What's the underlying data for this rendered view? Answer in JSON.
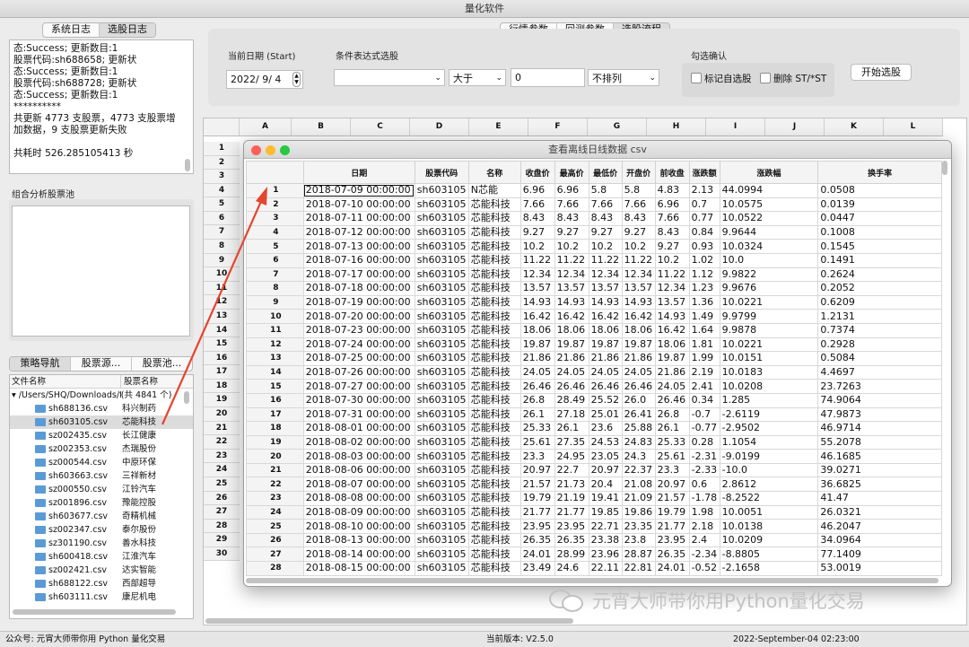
{
  "app": {
    "title": "量化软件"
  },
  "left": {
    "log_tabs": [
      "系统日志",
      "选股日志"
    ],
    "log_lines": [
      "态:Success; 更新数目:1",
      "股票代码:sh688658; 更新状",
      "态:Success; 更新数目:1",
      "股票代码:sh688728; 更新状",
      "态:Success; 更新数目:1",
      "**********",
      "共更新 4773 支股票，4773 支股票增",
      "加数据，9 支股票更新失败",
      "",
      "共耗时 526.285105413 秒"
    ],
    "combo_pool_title": "组合分析股票池",
    "nav_tabs": [
      "策略导航",
      "股票源...",
      "股票池..."
    ],
    "file_col_headers": [
      "文件名称",
      "股票名称"
    ],
    "root_path": "/Users/SHQ/Downloads/f",
    "root_count": "(共 4841 个)",
    "files": [
      {
        "file": "sh688136.csv",
        "name": "科兴制药"
      },
      {
        "file": "sh603105.csv",
        "name": "芯能科技"
      },
      {
        "file": "sz002435.csv",
        "name": "长江健康"
      },
      {
        "file": "sz002353.csv",
        "name": "杰瑞股份"
      },
      {
        "file": "sz000544.csv",
        "name": "中原环保"
      },
      {
        "file": "sh603663.csv",
        "name": "三祥新材"
      },
      {
        "file": "sz000550.csv",
        "name": "江铃汽车"
      },
      {
        "file": "sz001896.csv",
        "name": "豫能控股"
      },
      {
        "file": "sh603677.csv",
        "name": "奇精机械"
      },
      {
        "file": "sz002347.csv",
        "name": "泰尔股份"
      },
      {
        "file": "sz301190.csv",
        "name": "善水科技"
      },
      {
        "file": "sh600418.csv",
        "name": "江淮汽车"
      },
      {
        "file": "sz002421.csv",
        "name": "达实智能"
      },
      {
        "file": "sh688122.csv",
        "name": "西部超导"
      },
      {
        "file": "sh603111.csv",
        "name": "康尼机电"
      }
    ]
  },
  "top": {
    "tabs": [
      "行情参数",
      "回测参数",
      "选股流程"
    ],
    "date_label": "当前日期 (Start)",
    "date_value": "2022/  9/  4",
    "cond_label": "条件表达式选股",
    "cond_field": "",
    "operator": "大于",
    "threshold": "0",
    "sort": "不排列",
    "confirm_label": "勾选确认",
    "check_mark": "标记自选股",
    "check_del": "删除 ST/*ST",
    "start_button": "开始选股"
  },
  "sheet": {
    "cols": [
      "A",
      "B",
      "C",
      "D",
      "E",
      "F",
      "G",
      "H",
      "I",
      "J",
      "K",
      "L"
    ],
    "rows": [
      "1",
      "2",
      "3",
      "4",
      "5",
      "6",
      "7",
      "8",
      "9",
      "10",
      "11",
      "12",
      "13",
      "14",
      "15",
      "16",
      "17",
      "18",
      "19",
      "20",
      "21",
      "22",
      "23",
      "24",
      "25",
      "26",
      "27",
      "28",
      "29",
      "30"
    ]
  },
  "csv_window": {
    "title": "查看离线日线数据 csv",
    "headers": [
      "日期",
      "股票代码",
      "名称",
      "收盘价",
      "最高价",
      "最低价",
      "开盘价",
      "前收盘",
      "涨跌额",
      "涨跌幅",
      "换手率"
    ],
    "rows": [
      [
        "1",
        "2018-07-09 00:00:00",
        "sh603105",
        "N芯能",
        "6.96",
        "6.96",
        "5.8",
        "5.8",
        "4.83",
        "2.13",
        "44.0994",
        "0.0508"
      ],
      [
        "2",
        "2018-07-10 00:00:00",
        "sh603105",
        "芯能科技",
        "7.66",
        "7.66",
        "7.66",
        "7.66",
        "6.96",
        "0.7",
        "10.0575",
        "0.0139"
      ],
      [
        "3",
        "2018-07-11 00:00:00",
        "sh603105",
        "芯能科技",
        "8.43",
        "8.43",
        "8.43",
        "8.43",
        "7.66",
        "0.77",
        "10.0522",
        "0.0447"
      ],
      [
        "4",
        "2018-07-12 00:00:00",
        "sh603105",
        "芯能科技",
        "9.27",
        "9.27",
        "9.27",
        "9.27",
        "8.43",
        "0.84",
        "9.9644",
        "0.1008"
      ],
      [
        "5",
        "2018-07-13 00:00:00",
        "sh603105",
        "芯能科技",
        "10.2",
        "10.2",
        "10.2",
        "10.2",
        "9.27",
        "0.93",
        "10.0324",
        "0.1545"
      ],
      [
        "6",
        "2018-07-16 00:00:00",
        "sh603105",
        "芯能科技",
        "11.22",
        "11.22",
        "11.22",
        "11.22",
        "10.2",
        "1.02",
        "10.0",
        "0.1491"
      ],
      [
        "7",
        "2018-07-17 00:00:00",
        "sh603105",
        "芯能科技",
        "12.34",
        "12.34",
        "12.34",
        "12.34",
        "11.22",
        "1.12",
        "9.9822",
        "0.2624"
      ],
      [
        "8",
        "2018-07-18 00:00:00",
        "sh603105",
        "芯能科技",
        "13.57",
        "13.57",
        "13.57",
        "13.57",
        "12.34",
        "1.23",
        "9.9676",
        "0.2052"
      ],
      [
        "9",
        "2018-07-19 00:00:00",
        "sh603105",
        "芯能科技",
        "14.93",
        "14.93",
        "14.93",
        "14.93",
        "13.57",
        "1.36",
        "10.0221",
        "0.6209"
      ],
      [
        "10",
        "2018-07-20 00:00:00",
        "sh603105",
        "芯能科技",
        "16.42",
        "16.42",
        "16.42",
        "16.42",
        "14.93",
        "1.49",
        "9.9799",
        "1.2131"
      ],
      [
        "11",
        "2018-07-23 00:00:00",
        "sh603105",
        "芯能科技",
        "18.06",
        "18.06",
        "18.06",
        "18.06",
        "16.42",
        "1.64",
        "9.9878",
        "0.7374"
      ],
      [
        "12",
        "2018-07-24 00:00:00",
        "sh603105",
        "芯能科技",
        "19.87",
        "19.87",
        "19.87",
        "19.87",
        "18.06",
        "1.81",
        "10.0221",
        "0.2928"
      ],
      [
        "13",
        "2018-07-25 00:00:00",
        "sh603105",
        "芯能科技",
        "21.86",
        "21.86",
        "21.86",
        "21.86",
        "19.87",
        "1.99",
        "10.0151",
        "0.5084"
      ],
      [
        "14",
        "2018-07-26 00:00:00",
        "sh603105",
        "芯能科技",
        "24.05",
        "24.05",
        "24.05",
        "24.05",
        "21.86",
        "2.19",
        "10.0183",
        "4.4697"
      ],
      [
        "15",
        "2018-07-27 00:00:00",
        "sh603105",
        "芯能科技",
        "26.46",
        "26.46",
        "26.46",
        "26.46",
        "24.05",
        "2.41",
        "10.0208",
        "23.7263"
      ],
      [
        "16",
        "2018-07-30 00:00:00",
        "sh603105",
        "芯能科技",
        "26.8",
        "28.49",
        "25.52",
        "26.0",
        "26.46",
        "0.34",
        "1.285",
        "74.9064"
      ],
      [
        "17",
        "2018-07-31 00:00:00",
        "sh603105",
        "芯能科技",
        "26.1",
        "27.18",
        "25.01",
        "26.41",
        "26.8",
        "-0.7",
        "-2.6119",
        "47.9873"
      ],
      [
        "18",
        "2018-08-01 00:00:00",
        "sh603105",
        "芯能科技",
        "25.33",
        "26.1",
        "23.6",
        "25.88",
        "26.1",
        "-0.77",
        "-2.9502",
        "46.9714"
      ],
      [
        "19",
        "2018-08-02 00:00:00",
        "sh603105",
        "芯能科技",
        "25.61",
        "27.35",
        "24.53",
        "24.83",
        "25.33",
        "0.28",
        "1.1054",
        "55.2078"
      ],
      [
        "20",
        "2018-08-03 00:00:00",
        "sh603105",
        "芯能科技",
        "23.3",
        "24.95",
        "23.05",
        "24.3",
        "25.61",
        "-2.31",
        "-9.0199",
        "46.1685"
      ],
      [
        "21",
        "2018-08-06 00:00:00",
        "sh603105",
        "芯能科技",
        "20.97",
        "22.7",
        "20.97",
        "22.37",
        "23.3",
        "-2.33",
        "-10.0",
        "39.0271"
      ],
      [
        "22",
        "2018-08-07 00:00:00",
        "sh603105",
        "芯能科技",
        "21.57",
        "21.73",
        "20.4",
        "21.08",
        "20.97",
        "0.6",
        "2.8612",
        "36.6825"
      ],
      [
        "23",
        "2018-08-08 00:00:00",
        "sh603105",
        "芯能科技",
        "19.79",
        "21.19",
        "19.41",
        "21.09",
        "21.57",
        "-1.78",
        "-8.2522",
        "41.47"
      ],
      [
        "24",
        "2018-08-09 00:00:00",
        "sh603105",
        "芯能科技",
        "21.77",
        "21.77",
        "19.85",
        "19.86",
        "19.79",
        "1.98",
        "10.0051",
        "26.0321"
      ],
      [
        "25",
        "2018-08-10 00:00:00",
        "sh603105",
        "芯能科技",
        "23.95",
        "23.95",
        "22.71",
        "23.35",
        "21.77",
        "2.18",
        "10.0138",
        "46.2047"
      ],
      [
        "26",
        "2018-08-13 00:00:00",
        "sh603105",
        "芯能科技",
        "26.35",
        "26.35",
        "23.38",
        "23.8",
        "23.95",
        "2.4",
        "10.0209",
        "34.0964"
      ],
      [
        "27",
        "2018-08-14 00:00:00",
        "sh603105",
        "芯能科技",
        "24.01",
        "28.99",
        "23.96",
        "28.87",
        "26.35",
        "-2.34",
        "-8.8805",
        "77.1409"
      ],
      [
        "28",
        "2018-08-15 00:00:00",
        "sh603105",
        "芯能科技",
        "23.49",
        "24.6",
        "22.11",
        "22.81",
        "24.01",
        "-0.52",
        "-2.1658",
        "53.0019"
      ]
    ]
  },
  "watermark": "元宵大师带你用Python量化交易",
  "status": {
    "left": "公众号: 元宵大师带你用 Python 量化交易",
    "version": "当前版本: V2.5.0",
    "time": "2022-September-04 02:23:00"
  },
  "colors": {
    "arrow": "#e5452f",
    "folder": "#5b9bd5"
  }
}
